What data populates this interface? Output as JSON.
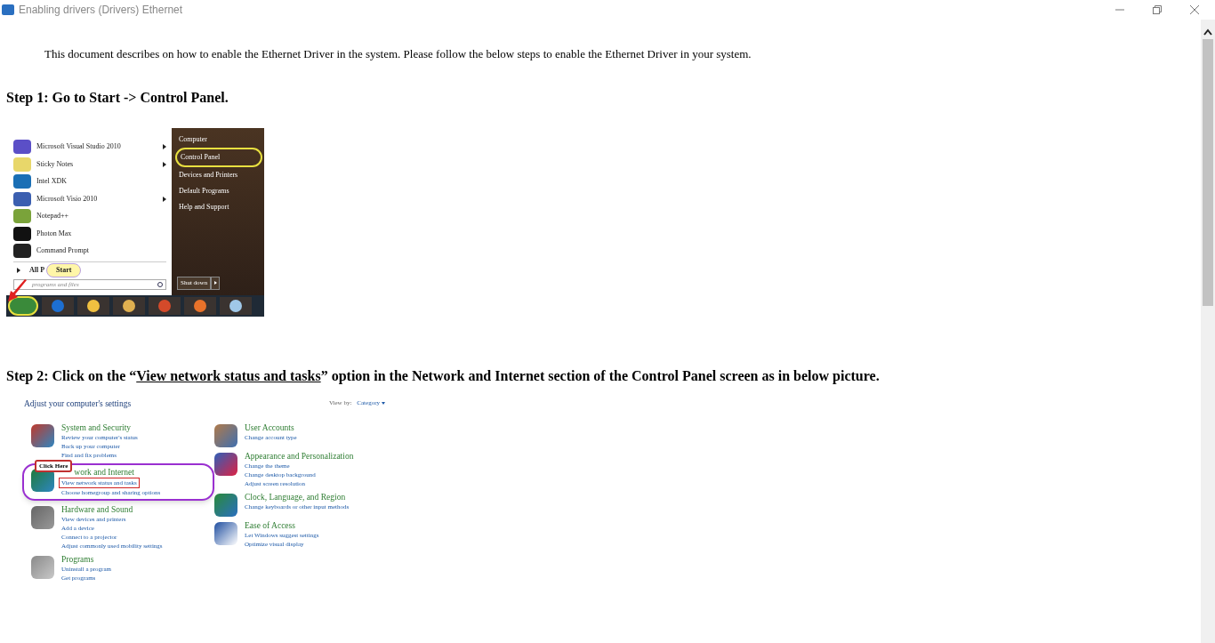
{
  "window": {
    "title": "Enabling drivers (Drivers) Ethernet"
  },
  "intro": "This document describes on how to enable the Ethernet Driver in the system. Please follow the below steps to enable the Ethernet Driver in your system.",
  "step1": {
    "heading": "Step 1: Go to Start -> Control Panel.",
    "start_menu": {
      "programs": [
        {
          "label": "Microsoft Visual Studio 2010",
          "submenu": true
        },
        {
          "label": "Sticky Notes",
          "submenu": true
        },
        {
          "label": "Intel XDK",
          "submenu": false
        },
        {
          "label": "Microsoft Visio 2010",
          "submenu": true
        },
        {
          "label": "Notepad++",
          "submenu": false
        },
        {
          "label": "Photon Max",
          "submenu": false
        },
        {
          "label": "Command Prompt",
          "submenu": false
        }
      ],
      "all_programs": "All P",
      "callout": "Start",
      "search_placeholder": "programs and files",
      "places": [
        {
          "label": "Computer",
          "circled": false
        },
        {
          "label": "Control Panel",
          "circled": true
        },
        {
          "label": "Devices and Printers",
          "circled": false
        },
        {
          "label": "Default Programs",
          "circled": false
        },
        {
          "label": "Help and Support",
          "circled": false
        }
      ],
      "shutdown": "Shut down"
    }
  },
  "step2": {
    "heading_before": "Step 2: Click on the “",
    "heading_link": "View network status and tasks",
    "heading_after": "” option in the Network and Internet section of the Control Panel screen as in below picture.",
    "control_panel": {
      "title": "Adjust your computer's settings",
      "view_by_label": "View by:",
      "view_by_value": "Category",
      "callout": "Click Here",
      "columns": [
        [
          {
            "title": "System and Security",
            "circled": false,
            "links": [
              {
                "text": "Review your computer's status",
                "boxed": false
              },
              {
                "text": "Back up your computer",
                "boxed": false
              },
              {
                "text": "Find and fix problems",
                "boxed": false
              }
            ]
          },
          {
            "title": "work and Internet",
            "circled": true,
            "links": [
              {
                "text": "View network status and tasks",
                "boxed": true
              },
              {
                "text": "Choose homegroup and sharing options",
                "boxed": false
              }
            ]
          },
          {
            "title": "Hardware and Sound",
            "circled": false,
            "links": [
              {
                "text": "View devices and printers",
                "boxed": false
              },
              {
                "text": "Add a device",
                "boxed": false
              },
              {
                "text": "Connect to a projector",
                "boxed": false
              },
              {
                "text": "Adjust commonly used mobility settings",
                "boxed": false
              }
            ]
          },
          {
            "title": "Programs",
            "circled": false,
            "links": [
              {
                "text": "Uninstall a program",
                "boxed": false
              },
              {
                "text": "Get programs",
                "boxed": false
              }
            ]
          }
        ],
        [
          {
            "title": "User Accounts",
            "circled": false,
            "links": [
              {
                "text": "Change account type",
                "boxed": false
              }
            ]
          },
          {
            "title": "Appearance and Personalization",
            "circled": false,
            "links": [
              {
                "text": "Change the theme",
                "boxed": false
              },
              {
                "text": "Change desktop background",
                "boxed": false
              },
              {
                "text": "Adjust screen resolution",
                "boxed": false
              }
            ]
          },
          {
            "title": "Clock, Language, and Region",
            "circled": false,
            "links": [
              {
                "text": "Change keyboards or other input methods",
                "boxed": false
              }
            ]
          },
          {
            "title": "Ease of Access",
            "circled": false,
            "links": [
              {
                "text": "Let Windows suggest settings",
                "boxed": false
              },
              {
                "text": "Optimize visual display",
                "boxed": false
              }
            ]
          }
        ]
      ]
    }
  }
}
